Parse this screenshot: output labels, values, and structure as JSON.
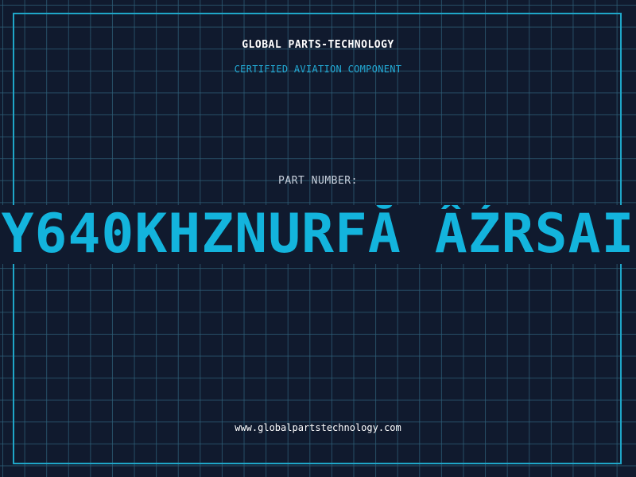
{
  "header": {
    "brand": "GLOBAL PARTS-TECHNOLOGY",
    "subtitle": "CERTIFIED AVIATION COMPONENT"
  },
  "part": {
    "label": "PART NUMBER:",
    "value": "Y640KHZNURFĂ ÂŹRSAI"
  },
  "footer": {
    "url": "www.globalpartstechnology.com"
  },
  "colors": {
    "background": "#101a2e",
    "grid": "#2e5f78",
    "accent": "#13b4dd",
    "text": "#ffffff"
  }
}
